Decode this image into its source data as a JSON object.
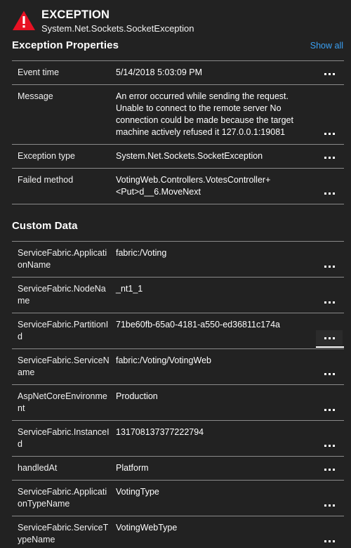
{
  "header": {
    "icon": "exception-warning-triangle-icon",
    "icon_color": "#e81123",
    "title": "EXCEPTION",
    "subtitle": "System.Net.Sockets.SocketException"
  },
  "exception_properties": {
    "section_title": "Exception Properties",
    "show_all_label": "Show all",
    "link_color": "#3aa0f3",
    "rows": [
      {
        "key": "Event time",
        "value": "5/14/2018 5:03:09 PM",
        "menu_label": "...",
        "active": false
      },
      {
        "key": "Message",
        "value": "An error occurred while sending the request. Unable to connect to the remote server No connection could be made because the target machine actively refused it 127.0.0.1:19081",
        "menu_label": "...",
        "active": false
      },
      {
        "key": "Exception type",
        "value": "System.Net.Sockets.SocketException",
        "menu_label": "...",
        "active": false
      },
      {
        "key": "Failed method",
        "value": "VotingWeb.Controllers.VotesController+<Put>d__6.MoveNext",
        "menu_label": "...",
        "active": false
      }
    ]
  },
  "custom_data": {
    "section_title": "Custom Data",
    "rows": [
      {
        "key": "ServiceFabric.ApplicationName",
        "value": "fabric:/Voting",
        "menu_label": "...",
        "active": false
      },
      {
        "key": "ServiceFabric.NodeName",
        "value": "_nt1_1",
        "menu_label": "...",
        "active": false
      },
      {
        "key": "ServiceFabric.PartitionId",
        "value": "71be60fb-65a0-4181-a550-ed36811c174a",
        "menu_label": "...",
        "active": true
      },
      {
        "key": "ServiceFabric.ServiceName",
        "value": "fabric:/Voting/VotingWeb",
        "menu_label": "...",
        "active": false
      },
      {
        "key": "AspNetCoreEnvironment",
        "value": "Production",
        "menu_label": "...",
        "active": false
      },
      {
        "key": "ServiceFabric.InstanceId",
        "value": "131708137377222794",
        "menu_label": "...",
        "active": false
      },
      {
        "key": "handledAt",
        "value": "Platform",
        "menu_label": "...",
        "active": false
      },
      {
        "key": "ServiceFabric.ApplicationTypeName",
        "value": "VotingType",
        "menu_label": "...",
        "active": false
      },
      {
        "key": "ServiceFabric.ServiceTypeName",
        "value": "VotingWebType",
        "menu_label": "...",
        "active": false
      }
    ]
  }
}
